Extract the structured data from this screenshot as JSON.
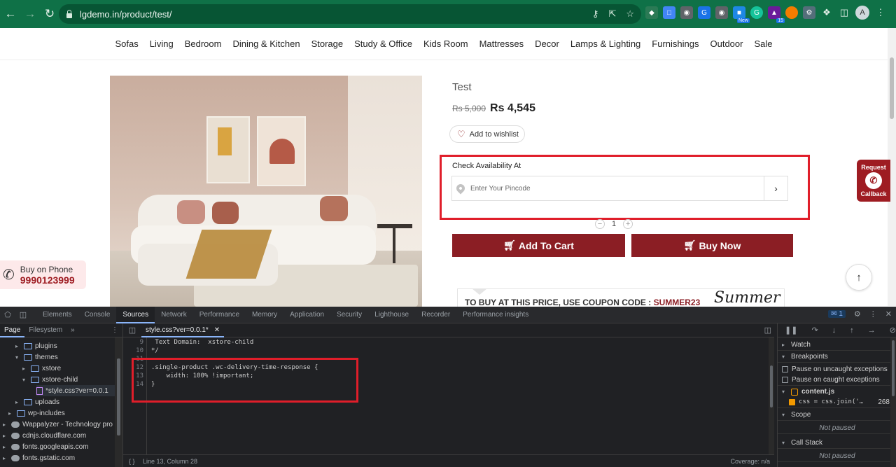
{
  "browser": {
    "url": "lgdemo.in/product/test/",
    "avatar_letter": "A",
    "extension_badge_new": "New",
    "extension_badge_count": "15"
  },
  "site_nav": [
    "Sofas",
    "Living",
    "Bedroom",
    "Dining & Kitchen",
    "Storage",
    "Study & Office",
    "Kids Room",
    "Mattresses",
    "Decor",
    "Lamps & Lighting",
    "Furnishings",
    "Outdoor",
    "Sale"
  ],
  "product": {
    "title": "Test",
    "old_price": "Rs 5,000",
    "price": "Rs 4,545",
    "wishlist_label": "Add to wishlist",
    "availability_label": "Check Availability At",
    "pincode_placeholder": "Enter Your Pincode",
    "quantity": "1",
    "add_to_cart": "Add To Cart",
    "buy_now": "Buy Now",
    "coupon_prefix": "TO BUY AT THIS PRICE, USE COUPON CODE : ",
    "coupon_code": "SUMMER23",
    "banner_script": "Summer"
  },
  "callback": {
    "line1": "Request",
    "line2": "Callback"
  },
  "buy_on_phone": {
    "label": "Buy on Phone",
    "number": "9990123999"
  },
  "colors": {
    "brand_red": "#8b1e24",
    "chrome_green": "#0f7147",
    "highlight_red": "#e01e2a"
  },
  "devtools": {
    "tabs": [
      "Elements",
      "Console",
      "Sources",
      "Network",
      "Performance",
      "Memory",
      "Application",
      "Security",
      "Lighthouse",
      "Recorder",
      "Performance insights"
    ],
    "active_tab": "Sources",
    "message_count": "1",
    "left_tabs": [
      "Page",
      "Filesystem"
    ],
    "tree": [
      {
        "label": "plugins",
        "kind": "folder"
      },
      {
        "label": "themes",
        "kind": "folder"
      },
      {
        "label": "xstore",
        "kind": "folder"
      },
      {
        "label": "xstore-child",
        "kind": "folder"
      },
      {
        "label": "*style.css?ver=0.0.1",
        "kind": "file"
      },
      {
        "label": "uploads",
        "kind": "folder"
      },
      {
        "label": "wp-includes",
        "kind": "folder"
      },
      {
        "label": "Wappalyzer - Technology pro",
        "kind": "cloud"
      },
      {
        "label": "cdnjs.cloudflare.com",
        "kind": "cloud"
      },
      {
        "label": "fonts.googleapis.com",
        "kind": "cloud"
      },
      {
        "label": "fonts.gstatic.com",
        "kind": "cloud"
      }
    ],
    "editor_tab": "style.css?ver=0.0.1*",
    "code_lines": [
      {
        "n": "9",
        "text": " Text Domain:  xstore-child"
      },
      {
        "n": "10",
        "text": "*/"
      },
      {
        "n": "11",
        "text": ""
      },
      {
        "n": "12",
        "text": ".single-product .wc-delivery-time-response {"
      },
      {
        "n": "13",
        "text": "    width: 100% !important;"
      },
      {
        "n": "14",
        "text": "}"
      }
    ],
    "status_position": "Line 13, Column 28",
    "status_coverage": "Coverage: n/a",
    "right_pane": {
      "watch": "Watch",
      "breakpoints": "Breakpoints",
      "pause_uncaught": "Pause on uncaught exceptions",
      "pause_caught": "Pause on caught exceptions",
      "content_js": "content.js",
      "bp_code": "css = css.join('…",
      "bp_line": "268",
      "scope": "Scope",
      "not_paused_1": "Not paused",
      "call_stack": "Call Stack",
      "not_paused_2": "Not paused"
    }
  }
}
